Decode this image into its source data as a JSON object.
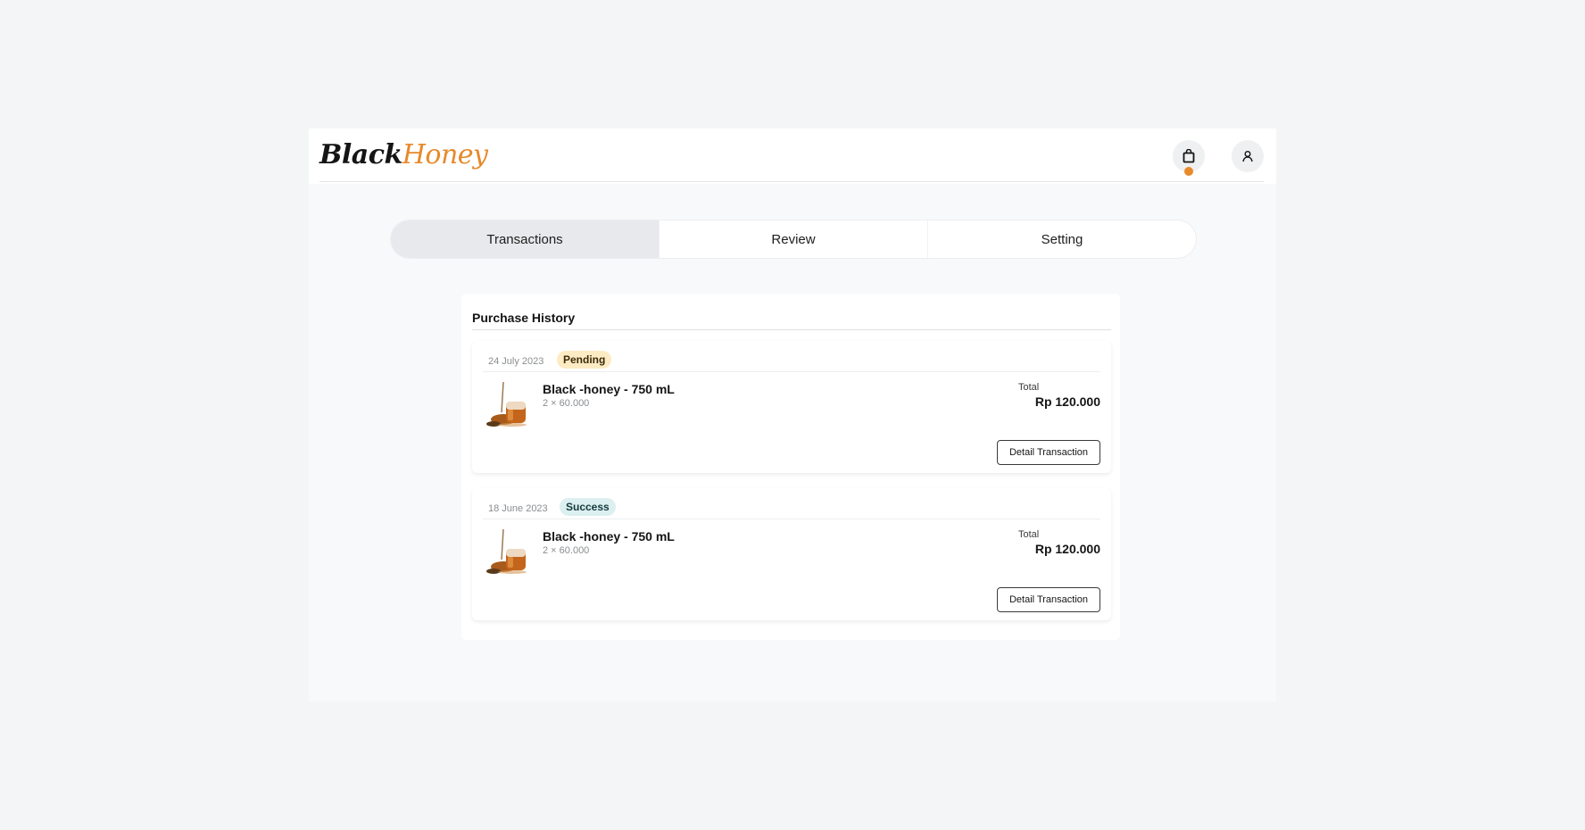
{
  "brand": {
    "logo_part1": "Black",
    "logo_part2": "Honey",
    "accent_color": "#e8892a"
  },
  "nav": {
    "cart_icon": "shopping-bag-icon",
    "user_icon": "user-icon",
    "cart_has_notification": true
  },
  "tabs": [
    {
      "label": "Transactions",
      "active": true
    },
    {
      "label": "Review",
      "active": false
    },
    {
      "label": "Setting",
      "active": false
    }
  ],
  "purchase_history": {
    "title": "Purchase History",
    "orders": [
      {
        "date": "24 July 2023",
        "status": "Pending",
        "status_color": "#fdebc4",
        "product_name": "Black -honey - 750 mL",
        "quantity_price": "2 × 60.000",
        "total_label": "Total",
        "total_value": "Rp 120.000",
        "action_label": "Detail Transaction"
      },
      {
        "date": "18 June 2023",
        "status": "Success",
        "status_color": "#dceff1",
        "product_name": "Black -honey - 750 mL",
        "quantity_price": "2 × 60.000",
        "total_label": "Total",
        "total_value": "Rp 120.000",
        "action_label": "Detail Transaction"
      }
    ]
  }
}
